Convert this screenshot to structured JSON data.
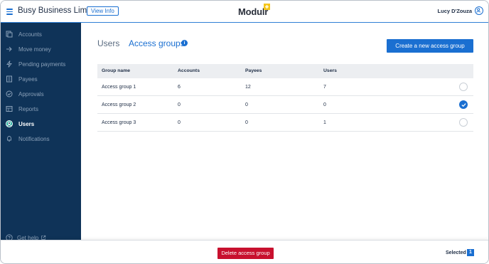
{
  "header": {
    "company": "Busy Business Limited",
    "view_info": "View Info",
    "logo": "Modulr",
    "user_name": "Lucy D'Zouza"
  },
  "sidebar": {
    "items": [
      {
        "label": "Accounts",
        "icon": "accounts-icon"
      },
      {
        "label": "Move money",
        "icon": "move-money-icon"
      },
      {
        "label": "Pending payments",
        "icon": "lightning-icon"
      },
      {
        "label": "Payees",
        "icon": "payees-icon"
      },
      {
        "label": "Approvals",
        "icon": "check-circle-icon"
      },
      {
        "label": "Reports",
        "icon": "reports-icon"
      },
      {
        "label": "Users",
        "icon": "users-icon",
        "active": true
      },
      {
        "label": "Notifications",
        "icon": "bell-icon"
      }
    ],
    "help": "Get help"
  },
  "tabs": {
    "users": "Users",
    "access_groups": "Access groups",
    "info": "i"
  },
  "create_button": "Create a new access group",
  "table": {
    "headers": [
      "Group name",
      "Accounts",
      "Payees",
      "Users"
    ],
    "rows": [
      {
        "name": "Access group 1",
        "accounts": "6",
        "payees": "12",
        "users": "7",
        "selected": false
      },
      {
        "name": "Access group 2",
        "accounts": "0",
        "payees": "0",
        "users": "0",
        "selected": true
      },
      {
        "name": "Access group 3",
        "accounts": "0",
        "payees": "0",
        "users": "1",
        "selected": false
      }
    ]
  },
  "footer": {
    "delete_button": "Delete access group",
    "selected_label": "Selected",
    "selected_count": "1"
  },
  "colors": {
    "accent": "#1a6fd1",
    "sidebar": "#0f3358",
    "danger": "#c8102e",
    "logo_mark": "#f5c518"
  }
}
